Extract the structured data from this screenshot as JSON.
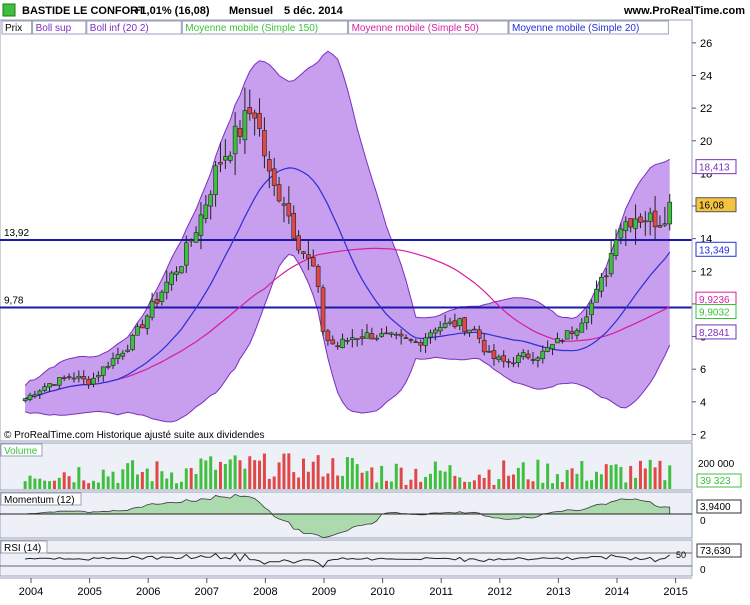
{
  "header": {
    "title": "BASTIDE LE CONFORT",
    "change": "+1,01% (16,08)",
    "period": "Mensuel",
    "date": "5 déc. 2014",
    "site": "www.ProRealTime.com"
  },
  "legend": [
    {
      "label": "Prix",
      "color": "#000000"
    },
    {
      "label": "Boll sup",
      "color": "#7b2fbe"
    },
    {
      "label": "Boll inf (20 2)",
      "color": "#7b2fbe"
    },
    {
      "label": "Moyenne mobile (Simple 150)",
      "color": "#39c239"
    },
    {
      "label": "Moyenne mobile (Simple 50)",
      "color": "#d81fa6"
    },
    {
      "label": "Moyenne mobile (Simple 20)",
      "color": "#2030d8"
    }
  ],
  "footer_note": "© ProRealTime.com Historique ajusté suite aux dividendes",
  "colors": {
    "up": "#3fbf3f",
    "down": "#e04848",
    "band_fill": "#b57ee8",
    "band_line": "#7a2fc0",
    "ma20": "#2b2fd6",
    "ma50": "#d61e9c",
    "hline": "#1a1aa8",
    "panel_bg": "#eef0f8"
  },
  "chart_data": {
    "type": "candlestick",
    "ylim": [
      1.6,
      27.4
    ],
    "yticks": [
      "2",
      "4",
      "6",
      "8",
      "10",
      "12",
      "14",
      "16",
      "18",
      "20",
      "22",
      "24",
      "26"
    ],
    "xticks": [
      "2004",
      "2005",
      "2006",
      "2007",
      "2008",
      "2009",
      "2010",
      "2011",
      "2012",
      "2013",
      "2014",
      "2015"
    ],
    "hlines": [
      {
        "label": "13,92",
        "value": 13.92
      },
      {
        "label": "9,78",
        "value": 9.78
      }
    ],
    "price_tags": [
      {
        "label": "18,413",
        "value": 18.413,
        "color": "#7b2fbe",
        "highlight": false
      },
      {
        "label": "16,08",
        "value": 16.08,
        "color": "#000000",
        "highlight": true
      },
      {
        "label": "13,349",
        "value": 13.349,
        "color": "#2030d8",
        "highlight": false
      },
      {
        "label": "9,9236",
        "value": 9.9236,
        "color": "#d81fa6",
        "highlight": false
      },
      {
        "label": "9,9032",
        "value": 9.9032,
        "color": "#39c239",
        "highlight": false
      },
      {
        "label": "8,2841",
        "value": 8.2841,
        "color": "#7b2fbe",
        "highlight": false
      }
    ],
    "close_anchors": [
      [
        2003.9,
        4.2
      ],
      [
        2004.3,
        5.1
      ],
      [
        2004.7,
        5.6
      ],
      [
        2005.0,
        5.2
      ],
      [
        2005.3,
        6.3
      ],
      [
        2005.7,
        7.6
      ],
      [
        2006.0,
        9.4
      ],
      [
        2006.3,
        11.2
      ],
      [
        2006.6,
        12.8
      ],
      [
        2006.9,
        15.4
      ],
      [
        2007.2,
        18.6
      ],
      [
        2007.5,
        20.3
      ],
      [
        2007.8,
        22.1
      ],
      [
        2007.95,
        19.8
      ],
      [
        2008.1,
        17.2
      ],
      [
        2008.3,
        16.6
      ],
      [
        2008.5,
        14.3
      ],
      [
        2008.7,
        12.8
      ],
      [
        2008.85,
        12.0
      ],
      [
        2009.0,
        8.0
      ],
      [
        2009.2,
        7.4
      ],
      [
        2009.5,
        8.0
      ],
      [
        2009.8,
        8.1
      ],
      [
        2010.2,
        7.9
      ],
      [
        2010.6,
        7.6
      ],
      [
        2010.9,
        8.6
      ],
      [
        2011.3,
        8.8
      ],
      [
        2011.6,
        8.3
      ],
      [
        2011.8,
        6.8
      ],
      [
        2012.1,
        6.4
      ],
      [
        2012.4,
        6.8
      ],
      [
        2012.7,
        6.9
      ],
      [
        2013.0,
        7.7
      ],
      [
        2013.3,
        8.6
      ],
      [
        2013.6,
        10.2
      ],
      [
        2013.85,
        12.3
      ],
      [
        2014.0,
        14.7
      ],
      [
        2014.3,
        15.4
      ],
      [
        2014.6,
        15.2
      ],
      [
        2014.75,
        15.1
      ],
      [
        2014.9,
        16.08
      ]
    ],
    "volume": {
      "label": "Volume",
      "ytick": "200 000",
      "last_value": "39 323"
    },
    "momentum": {
      "label": "Momentum (12)",
      "last_value": "3,9400",
      "ytick": "0"
    },
    "rsi": {
      "label": "RSI (14)",
      "last_value": "73,630",
      "ytick_top": "50",
      "ytick_bottom": "0"
    }
  }
}
